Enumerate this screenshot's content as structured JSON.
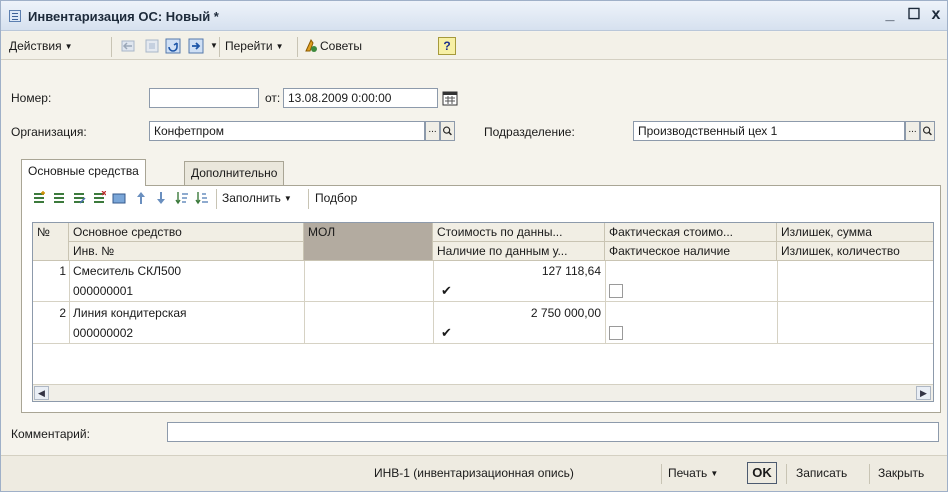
{
  "window": {
    "title": "Инвентаризация ОС: Новый *",
    "minimize": "_",
    "maximize": "☐",
    "close": "x"
  },
  "toolbar": {
    "actions_label": "Действия",
    "goto_label": "Перейти",
    "tips_label": "Советы",
    "help_label": "?"
  },
  "form": {
    "number_label": "Номер:",
    "number_value": "",
    "date_label": "от:",
    "date_value": "13.08.2009 0:00:00",
    "org_label": "Организация:",
    "org_value": "Конфетпром",
    "dept_label": "Подразделение:",
    "dept_value": "Производственный цех 1",
    "select_btn": "...",
    "comment_label": "Комментарий:",
    "comment_value": ""
  },
  "tabs": [
    {
      "label": "Основные средства",
      "active": true
    },
    {
      "label": "Дополнительно",
      "active": false
    }
  ],
  "table_toolbar": {
    "fill_label": "Заполнить",
    "pick_label": "Подбор"
  },
  "table": {
    "headers_row1": [
      "№",
      "Основное средство",
      "МОЛ",
      "Стоимость по данны...",
      "Фактическая стоимо...",
      "Излишек, сумма"
    ],
    "headers_row2": [
      "Инв. №",
      "Наличие по данным у...",
      "Фактическое наличие",
      "Излишек, количество"
    ],
    "rows": [
      {
        "num": "1",
        "name": "Смеситель СКЛ500",
        "inv": "000000001",
        "mol": "",
        "cost": "127 118,64",
        "present": true,
        "fact_present": false
      },
      {
        "num": "2",
        "name": "Линия кондитерская",
        "inv": "000000002",
        "mol": "",
        "cost": "2 750 000,00",
        "present": true,
        "fact_present": false
      }
    ]
  },
  "bottom": {
    "form_label": "ИНВ-1 (инвентаризационная опись)",
    "print_label": "Печать",
    "ok_label": "OK",
    "save_label": "Записать",
    "close_label": "Закрыть"
  },
  "colors": {
    "accent": "#f7f0a5",
    "mol_header": "#b3aba0",
    "title_bg": "#d6e1ef"
  }
}
